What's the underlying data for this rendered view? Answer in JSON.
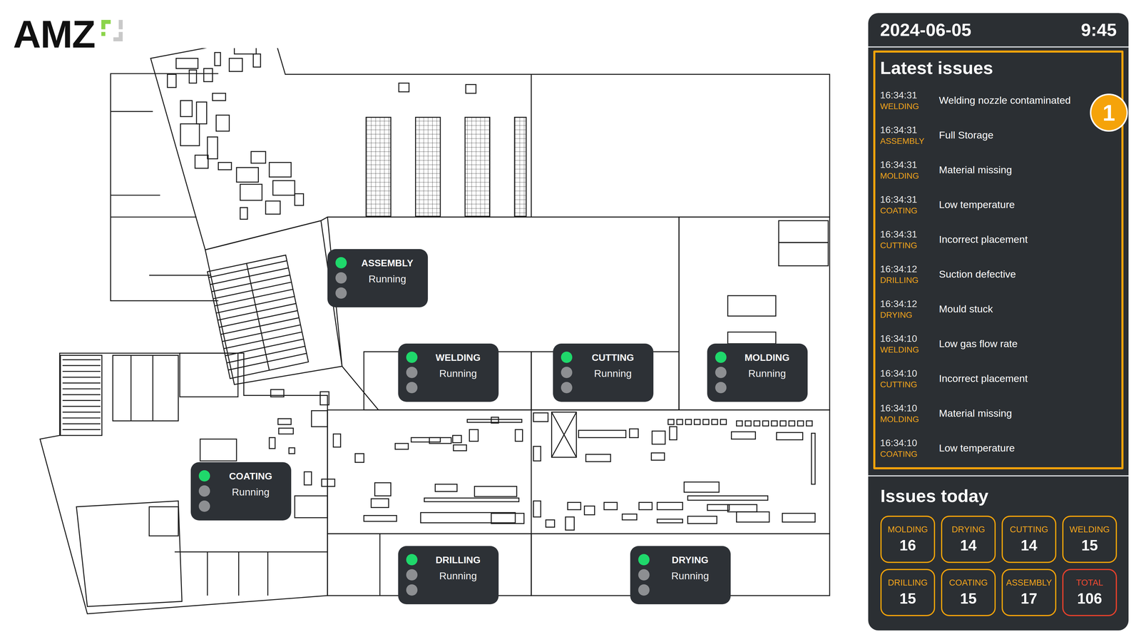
{
  "logo": {
    "text": "AMZ"
  },
  "map": {
    "stations": [
      {
        "name": "ASSEMBLY",
        "status": "Running",
        "lights": [
          {
            "on": true
          },
          {
            "on": false
          },
          {
            "on": false
          }
        ]
      },
      {
        "name": "WELDING",
        "status": "Running",
        "lights": [
          {
            "on": true
          },
          {
            "on": false
          },
          {
            "on": false
          }
        ]
      },
      {
        "name": "CUTTING",
        "status": "Running",
        "lights": [
          {
            "on": true
          },
          {
            "on": false
          },
          {
            "on": false
          }
        ]
      },
      {
        "name": "MOLDING",
        "status": "Running",
        "lights": [
          {
            "on": true
          },
          {
            "on": false
          },
          {
            "on": false
          }
        ]
      },
      {
        "name": "COATING",
        "status": "Running",
        "lights": [
          {
            "on": true
          },
          {
            "on": false
          },
          {
            "on": false
          }
        ]
      },
      {
        "name": "DRILLING",
        "status": "Running",
        "lights": [
          {
            "on": true
          },
          {
            "on": false
          },
          {
            "on": false
          }
        ]
      },
      {
        "name": "DRYING",
        "status": "Running",
        "lights": [
          {
            "on": true
          },
          {
            "on": false
          },
          {
            "on": false
          }
        ]
      }
    ]
  },
  "panel": {
    "date": "2024-06-05",
    "time": "9:45",
    "latest_issues": {
      "title": "Latest issues",
      "badge": "1",
      "items": [
        {
          "time": "16:34:31",
          "station": "WELDING",
          "message": "Welding nozzle contaminated"
        },
        {
          "time": "16:34:31",
          "station": "ASSEMBLY",
          "message": "Full Storage"
        },
        {
          "time": "16:34:31",
          "station": "MOLDING",
          "message": "Material missing"
        },
        {
          "time": "16:34:31",
          "station": "COATING",
          "message": "Low temperature"
        },
        {
          "time": "16:34:31",
          "station": "CUTTING",
          "message": "Incorrect placement"
        },
        {
          "time": "16:34:12",
          "station": "DRILLING",
          "message": "Suction defective"
        },
        {
          "time": "16:34:12",
          "station": "DRYING",
          "message": "Mould stuck"
        },
        {
          "time": "16:34:10",
          "station": "WELDING",
          "message": "Low gas flow rate"
        },
        {
          "time": "16:34:10",
          "station": "CUTTING",
          "message": "Incorrect placement"
        },
        {
          "time": "16:34:10",
          "station": "MOLDING",
          "message": "Material missing"
        },
        {
          "time": "16:34:10",
          "station": "COATING",
          "message": "Low temperature"
        }
      ]
    },
    "issues_today": {
      "title": "Issues today",
      "counts": [
        {
          "label": "MOLDING",
          "value": "16",
          "kind": "station"
        },
        {
          "label": "DRYING",
          "value": "14",
          "kind": "station"
        },
        {
          "label": "CUTTING",
          "value": "14",
          "kind": "station"
        },
        {
          "label": "WELDING",
          "value": "15",
          "kind": "station"
        },
        {
          "label": "DRILLING",
          "value": "15",
          "kind": "station"
        },
        {
          "label": "COATING",
          "value": "15",
          "kind": "station"
        },
        {
          "label": "ASSEMBLY",
          "value": "17",
          "kind": "station"
        },
        {
          "label": "TOTAL",
          "value": "106",
          "kind": "total"
        }
      ]
    }
  }
}
